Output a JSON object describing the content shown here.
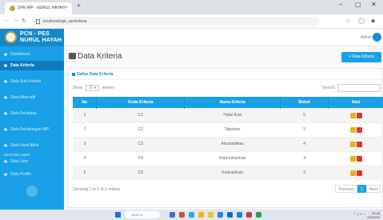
{
  "browser": {
    "tab_title": "SPK-WP - NURUL HAYAH",
    "tab_close": "×",
    "new_tab": "+",
    "url": "localhost/spk_wp/kriteria",
    "win_min": "–",
    "win_max": "▢",
    "win_close": "✕"
  },
  "sidebar": {
    "brand_line1": "PCN - PES",
    "brand_line2": "NURUL HAYAH",
    "items": [
      {
        "label": "Dashboard"
      },
      {
        "label": "Data Kriteria"
      },
      {
        "label": "Data Sub Kriteria"
      },
      {
        "label": "Data Alternatif"
      },
      {
        "label": "Data Penilaian"
      },
      {
        "label": "Data Perhitungan WP"
      },
      {
        "label": "Data Hasil Akhir"
      },
      {
        "label": "Data User"
      },
      {
        "label": "Data Profile"
      }
    ],
    "section_head": "MASTER USER"
  },
  "topbar": {
    "user_name": "Admin"
  },
  "page": {
    "title": "Data Kriteria",
    "add_button": "+ Data Kriteria"
  },
  "card": {
    "title": "Daftar Data Kriteria",
    "show_prefix": "Show",
    "show_value": "10",
    "show_suffix": "entries",
    "search_label": "Search:"
  },
  "table": {
    "headers": [
      "No",
      "Kode Kriteria",
      "Nama Kriteria",
      "Bobot",
      "Aksi"
    ],
    "rows": [
      [
        "1",
        "C1",
        "Hafal Ayat",
        "5"
      ],
      [
        "2",
        "C2",
        "Tajwidan",
        "5"
      ],
      [
        "3",
        "C3",
        "Akuntabilitas",
        "4"
      ],
      [
        "4",
        "C4",
        "Kepemimpinan",
        "4"
      ],
      [
        "5",
        "C5",
        "Kedisiplinan",
        "3"
      ]
    ]
  },
  "footer": {
    "info": "Showing 1 to 5 of 5 entries",
    "prev": "Previous",
    "page": "1",
    "next": "Next"
  },
  "taskbar": {
    "search": "Search",
    "tray": "^ ♫ ◐ ⌁",
    "time": "20:45",
    "date": "6/9/2024"
  },
  "colors": {
    "accent": "#1aa0e6",
    "sidebar": "#1aa0e6",
    "edit": "#f0ad1e",
    "delete": "#e0362c"
  }
}
